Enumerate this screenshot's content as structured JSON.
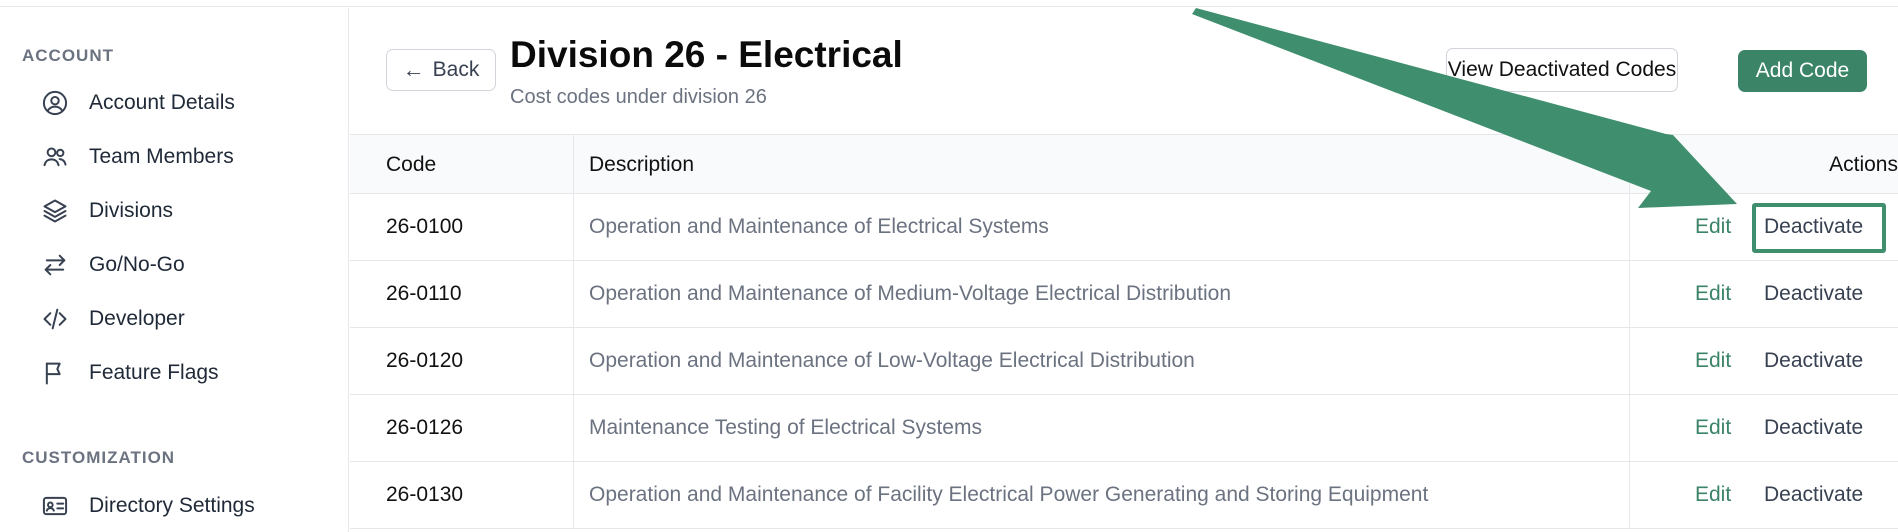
{
  "sidebar": {
    "sections": [
      {
        "heading": "ACCOUNT",
        "items": [
          {
            "label": "Account Details",
            "icon": "user-circle-icon"
          },
          {
            "label": "Team Members",
            "icon": "users-icon"
          },
          {
            "label": "Divisions",
            "icon": "layers-icon"
          },
          {
            "label": "Go/No-Go",
            "icon": "arrows-swap-icon"
          },
          {
            "label": "Developer",
            "icon": "code-icon"
          },
          {
            "label": "Feature Flags",
            "icon": "flag-icon"
          }
        ]
      },
      {
        "heading": "CUSTOMIZATION",
        "items": [
          {
            "label": "Directory Settings",
            "icon": "id-card-icon"
          }
        ]
      }
    ]
  },
  "header": {
    "back_label": "Back",
    "title": "Division 26 - Electrical",
    "subtitle": "Cost codes under division 26",
    "view_deactivated_label": "View Deactivated Codes",
    "add_code_label": "Add Code"
  },
  "table": {
    "columns": {
      "code": "Code",
      "description": "Description",
      "actions": "Actions"
    },
    "edit_label": "Edit",
    "deactivate_label": "Deactivate",
    "rows": [
      {
        "code": "26-0100",
        "description": "Operation and Maintenance of Electrical Systems"
      },
      {
        "code": "26-0110",
        "description": "Operation and Maintenance of Medium-Voltage Electrical Distribution"
      },
      {
        "code": "26-0120",
        "description": "Operation and Maintenance of Low-Voltage Electrical Distribution"
      },
      {
        "code": "26-0126",
        "description": "Maintenance Testing of Electrical Systems"
      },
      {
        "code": "26-0130",
        "description": "Operation and Maintenance of Facility Electrical Power Generating and Storing Equipment"
      }
    ]
  },
  "colors": {
    "accent": "#3b8468",
    "annotation": "#3f8f6e"
  }
}
